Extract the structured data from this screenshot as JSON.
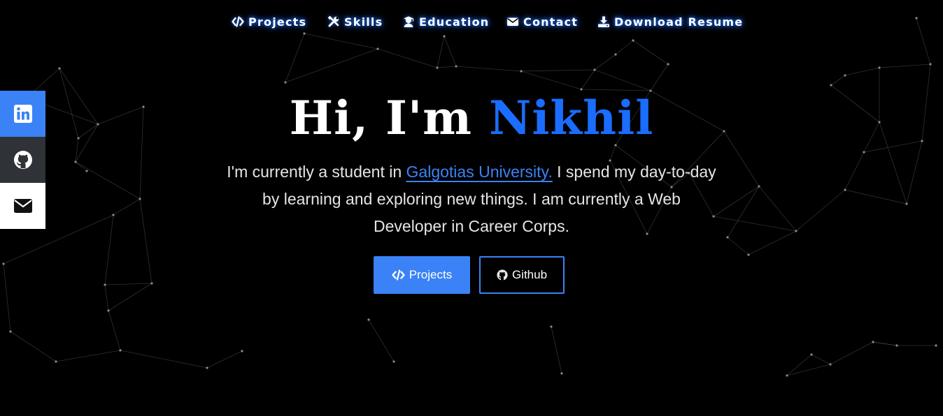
{
  "nav": {
    "projects": "Projects",
    "skills": "Skills",
    "education": "Education",
    "contact": "Contact",
    "resume": "Download Resume"
  },
  "hero": {
    "greeting": "Hi, I'm ",
    "name": "Nikhil",
    "intro_before": "I'm currently a student in ",
    "university": "Galgotias University.",
    "intro_after": " I spend my day-to-day by learning and exploring new things. I am currently a Web Developer in Career Corps.",
    "projects_button": "Projects",
    "github_button": "Github"
  },
  "social": [
    "linkedin-icon",
    "github-icon",
    "mail-icon"
  ],
  "colors": {
    "accent": "#3b82f6",
    "name": "#1a6dff",
    "background": "#000000"
  }
}
